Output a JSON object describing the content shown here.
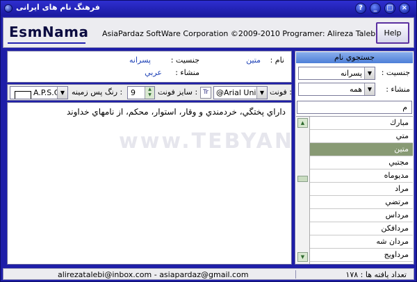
{
  "window": {
    "title": "فرهنگ نام های ايرانی",
    "controls": {
      "help": "?",
      "minimize": "_",
      "maximize": "□",
      "close": "×"
    }
  },
  "header": {
    "logo": "EsmNama",
    "credits": "AsiaPardaz SoftWare Corporation  ©2009-2010   Programer: Alireza Talebi",
    "help_label": "Help"
  },
  "info": {
    "name_label": "نام :",
    "name_value": "متين",
    "gender_label": "جنسيت :",
    "gender_value": "پسرانه",
    "origin_label": "منشاء :",
    "origin_value": "عربي"
  },
  "toolbar": {
    "font_label": "فونت :",
    "font_value": "@Arial Unicode",
    "font_icon": "font-file-icon",
    "size_label": "سايز فونت :",
    "size_value": "9",
    "bgcolor_label": "رنگ پس زمينه :",
    "bgcolor_value": "A.P.S.Color",
    "swatch_color": "#ffffff"
  },
  "description": {
    "text": "داراي پختگي، خردمندي و وقار، استوار، محكم، از نامهاي خداوند"
  },
  "watermark": "www.TEBYAN.Net",
  "search": {
    "header": "جستجوي نام",
    "gender_label": "جنسيت :",
    "gender_value": "پسرانه",
    "origin_label": "منشاء :",
    "origin_value": "همه",
    "query": "م",
    "results": [
      "مبارك",
      "متي",
      "متين",
      "مجتبي",
      "مديوماه",
      "مراد",
      "مرتضي",
      "مرداس",
      "مردافكن",
      "مردان شه",
      "مرداويج"
    ],
    "selected_index": 2
  },
  "status": {
    "emails": "alirezatalebi@inbox.com  -  asiapardaz@gmail.com",
    "count_label": "تعداد يافته ها :",
    "count_value": "١٧٨"
  },
  "colors": {
    "window_frame": "#1e1ea8",
    "search_header": "#6c95e2",
    "selected_row": "#889a74",
    "value_text": "#1b3fb5"
  }
}
